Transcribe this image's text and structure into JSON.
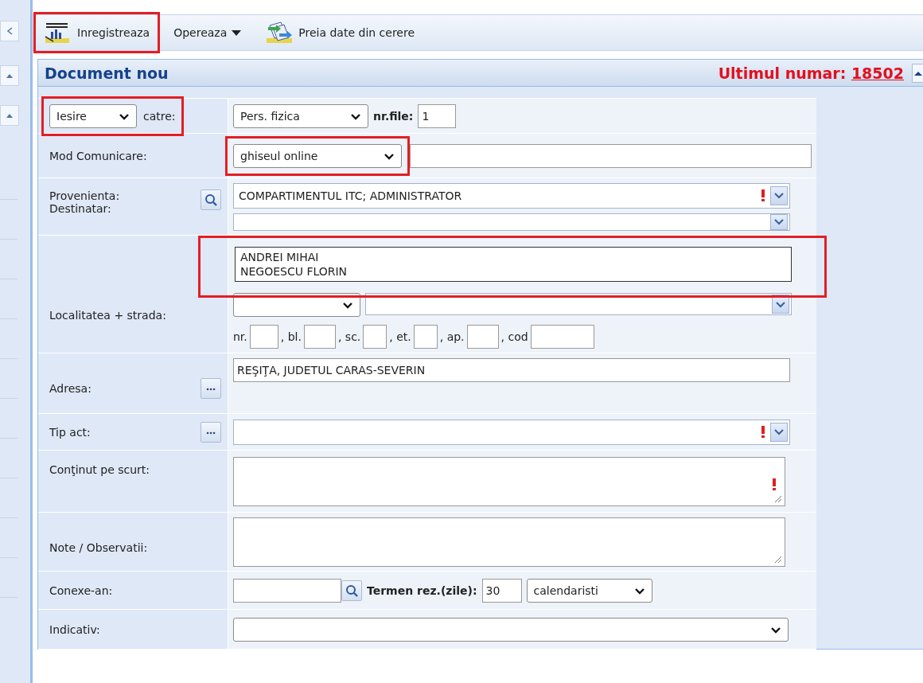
{
  "toolbar": {
    "items": [
      {
        "kind": "button",
        "label": "Inregistreaza",
        "highlighted": true
      },
      {
        "kind": "menu",
        "label": "Opereaza",
        "highlighted": false
      },
      {
        "kind": "button",
        "label": "Preia date din cerere",
        "highlighted": false
      }
    ]
  },
  "panel": {
    "title": "Document nou",
    "last_number_label": "Ultimul numar:",
    "last_number": "18502"
  },
  "form": {
    "direction": {
      "value": "Iesire",
      "label": "catre:",
      "highlighted": true
    },
    "recipient_type": {
      "value": "Pers. fizica"
    },
    "page_count": {
      "label": "nr.file:",
      "value": "1"
    },
    "communication": {
      "label": "Mod Comunicare:",
      "value": "ghiseul online",
      "highlighted": true
    },
    "origin": {
      "label": "Provenienta:",
      "value": "COMPARTIMENTUL ITC; ADMINISTRATOR",
      "required": true
    },
    "recipient": {
      "label": "Destinatar:",
      "highlighted": true,
      "suggestions": [
        "ANDREI MIHAI",
        "NEGOESCU FLORIN"
      ]
    },
    "locality": {
      "label": "Localitatea + strada:"
    },
    "address_parts": [
      {
        "label": "nr."
      },
      {
        "label": ", bl."
      },
      {
        "label": ", sc."
      },
      {
        "label": ", et."
      },
      {
        "label": ", ap."
      },
      {
        "label": ", cod"
      }
    ],
    "address": {
      "label": "Adresa:",
      "value": "REŞIŢA, JUDETUL CARAS-SEVERIN"
    },
    "act_type": {
      "label": "Tip act:",
      "required": true
    },
    "summary": {
      "label": "Conţinut pe scurt:",
      "required": true
    },
    "notes": {
      "label": "Note / Observatii:"
    },
    "related": {
      "label": "Conexe-an:"
    },
    "deadline": {
      "label": "Termen rez.(zile):",
      "value": "30",
      "unit": "calendaristi"
    },
    "code": {
      "label": "Indicativ:"
    }
  }
}
